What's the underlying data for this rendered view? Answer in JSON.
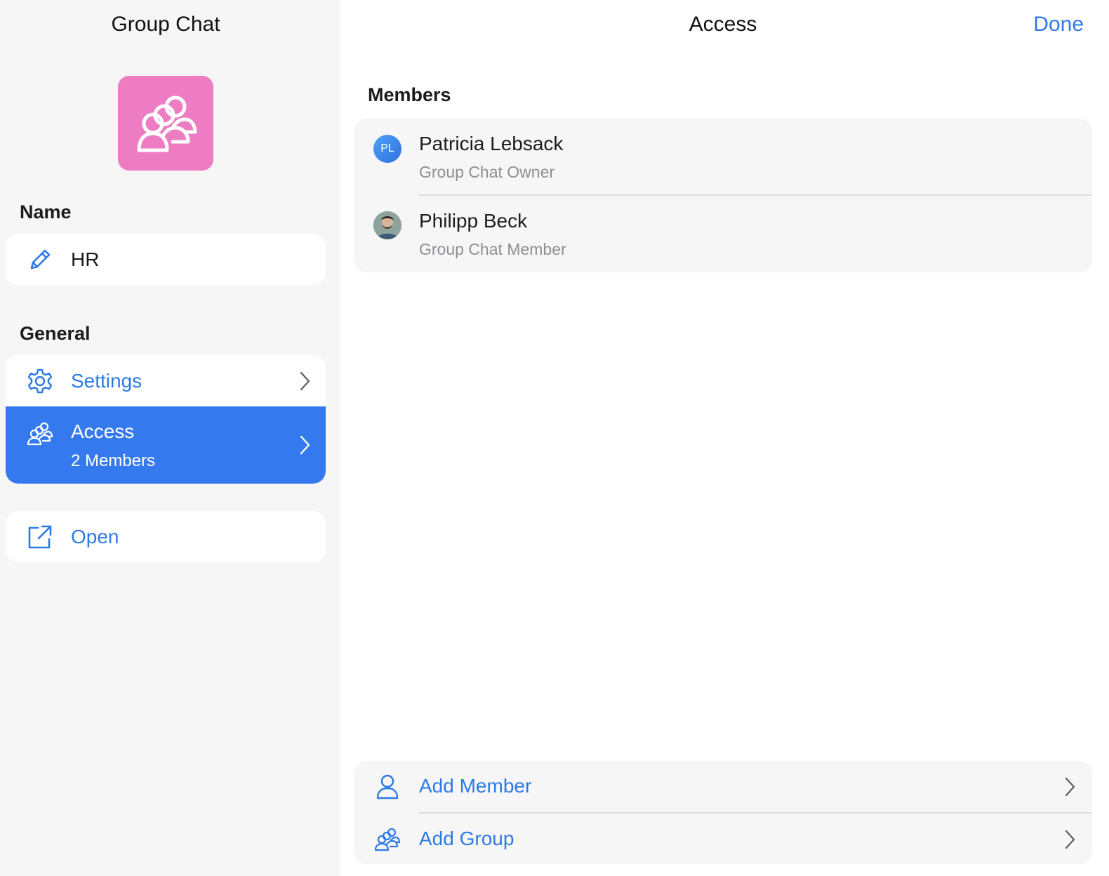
{
  "sidebar": {
    "title": "Group Chat",
    "avatar_color": "#ee7cc3",
    "avatar_icon": "group-icon",
    "name_section": {
      "header": "Name",
      "value": "HR",
      "icon": "pencil-icon"
    },
    "general_section": {
      "header": "General",
      "items": [
        {
          "label": "Settings",
          "icon": "gear-icon"
        },
        {
          "label": "Access",
          "sublabel": "2 Members",
          "icon": "group-icon",
          "selected": true
        }
      ]
    },
    "open": {
      "label": "Open",
      "icon": "external-link-icon"
    }
  },
  "main": {
    "title": "Access",
    "done_label": "Done",
    "members_header": "Members",
    "members": [
      {
        "initials": "PL",
        "name": "Patricia Lebsack",
        "role": "Group Chat Owner"
      },
      {
        "initials": "",
        "name": "Philipp Beck",
        "role": "Group Chat Member"
      }
    ],
    "actions": [
      {
        "label": "Add Member",
        "icon": "person-icon"
      },
      {
        "label": "Add Group",
        "icon": "group-icon"
      }
    ]
  },
  "colors": {
    "accent": "#2d7ae6",
    "selected_bg": "#3579ee",
    "secondary_text": "#8e8e93"
  }
}
